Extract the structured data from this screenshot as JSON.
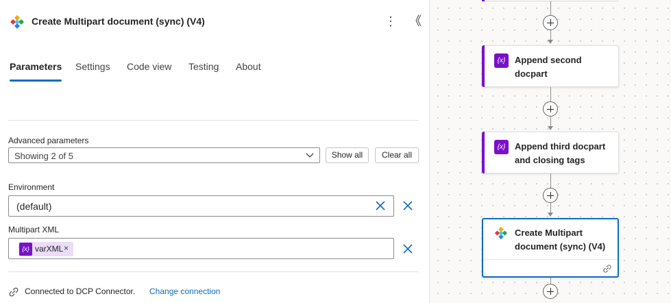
{
  "panel": {
    "title": "Create Multipart document (sync) (V4)",
    "more_label": "⋮",
    "collapse_label": "《",
    "tabs": [
      {
        "label": "Parameters"
      },
      {
        "label": "Settings"
      },
      {
        "label": "Code view"
      },
      {
        "label": "Testing"
      },
      {
        "label": "About"
      }
    ],
    "advanced": {
      "label": "Advanced parameters",
      "value": "Showing 2 of 5",
      "show_all": "Show all",
      "clear_all": "Clear all"
    },
    "environment": {
      "label": "Environment",
      "value": "(default)"
    },
    "multipart": {
      "label": "Multipart XML",
      "token_label": "varXML",
      "token_icon": "{x}"
    },
    "connection": {
      "text": "Connected to DCP Connector.",
      "link": "Change connection"
    }
  },
  "canvas": {
    "cards": [
      {
        "title": "Append second docpart",
        "icon": "{x}"
      },
      {
        "title": "Append third docpart and closing tags",
        "icon": "{x}"
      },
      {
        "title": "Create Multipart document (sync) (V4)"
      }
    ]
  },
  "colors": {
    "accent_blue": "#0f6cbd",
    "variable_purple": "#7a10c9",
    "token_bg": "#ebdcf7"
  }
}
